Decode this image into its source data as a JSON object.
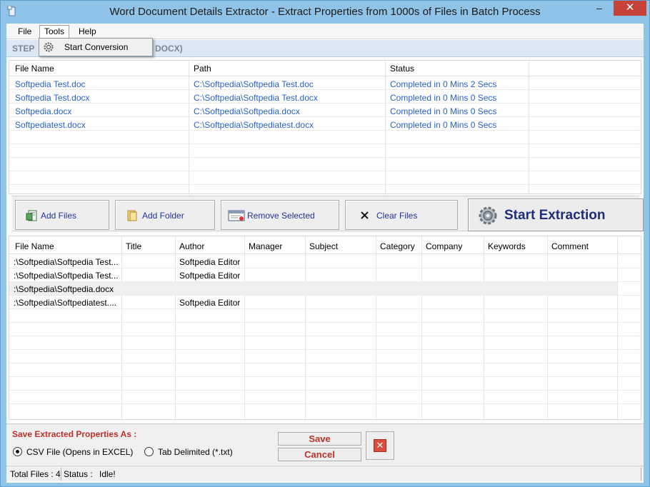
{
  "window": {
    "title": "Word Document Details Extractor - Extract Properties from 1000s of Files in Batch Process",
    "minimize": "–",
    "close": "✕"
  },
  "menu": {
    "file": "File",
    "tools": "Tools",
    "help": "Help",
    "tools_dropdown": [
      "Start Conversion"
    ]
  },
  "stepbar": {
    "step_label": "STEP",
    "step_suffix": "DOCX)"
  },
  "files_table": {
    "headers": [
      "File Name",
      "Path",
      "Status"
    ],
    "rows": [
      [
        "Softpedia Test.doc",
        "C:\\Softpedia\\Softpedia Test.doc",
        "Completed in 0 Mins 2 Secs"
      ],
      [
        "Softpedia Test.docx",
        "C:\\Softpedia\\Softpedia Test.docx",
        "Completed in 0 Mins 0 Secs"
      ],
      [
        "Softpedia.docx",
        "C:\\Softpedia\\Softpedia.docx",
        "Completed in 0 Mins 0 Secs"
      ],
      [
        "Softpediatest.docx",
        "C:\\Softpedia\\Softpediatest.docx",
        "Completed in 0 Mins 0 Secs"
      ]
    ]
  },
  "toolbar": {
    "add_files": "Add Files",
    "add_folder": "Add Folder",
    "remove_selected": "Remove Selected",
    "clear_files": "Clear Files",
    "start_extraction": "Start Extraction"
  },
  "props_table": {
    "headers": [
      "File Name",
      "Title",
      "Author",
      "Manager",
      "Subject",
      "Category",
      "Company",
      "Keywords",
      "Comment"
    ],
    "rows": [
      [
        ":\\Softpedia\\Softpedia Test...",
        "",
        "Softpedia Editor",
        "",
        "",
        "",
        "",
        "",
        ""
      ],
      [
        ":\\Softpedia\\Softpedia Test...",
        "",
        "Softpedia Editor",
        "",
        "",
        "",
        "",
        "",
        ""
      ],
      [
        ":\\Softpedia\\Softpedia.docx",
        "",
        "",
        "",
        "",
        "",
        "",
        "",
        ""
      ],
      [
        ":\\Softpedia\\Softpediatest....",
        "",
        "Softpedia Editor",
        "",
        "",
        "",
        "",
        "",
        ""
      ]
    ]
  },
  "save": {
    "heading": "Save Extracted Properties As :",
    "option_csv": "CSV File (Opens in EXCEL)",
    "option_tab": "Tab Delimited (*.txt)",
    "selected": "csv",
    "save_label": "Save",
    "cancel_label": "Cancel"
  },
  "status": {
    "total_files": "Total Files : 4",
    "status_label": "Status :",
    "status_value": "Idle!"
  },
  "colors": {
    "link": "#2a62c9",
    "accent_red": "#c0302a",
    "title_bg": "#8fc3e8"
  }
}
